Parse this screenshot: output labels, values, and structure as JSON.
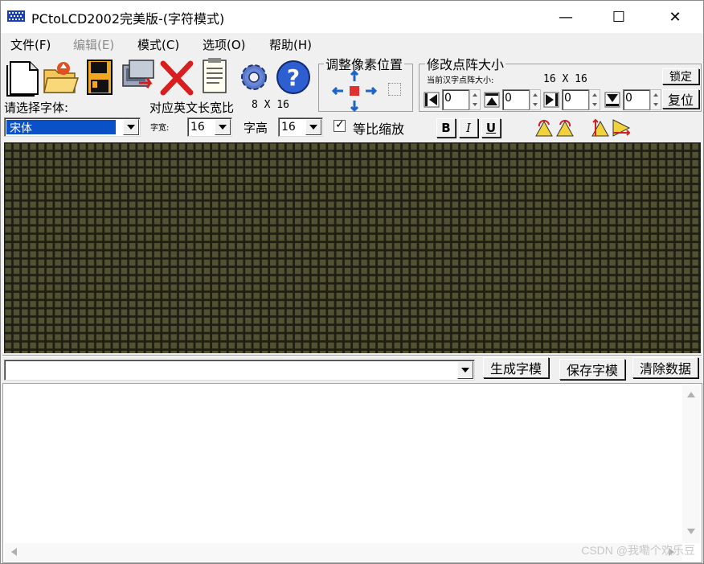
{
  "window": {
    "title": "PCtoLCD2002完美版-(字符模式)",
    "minimize_glyph": "—",
    "maximize_glyph": "☐",
    "close_glyph": "✕"
  },
  "menu": [
    {
      "label": "文件(F)",
      "disabled": false
    },
    {
      "label": "编辑(E)",
      "disabled": true
    },
    {
      "label": "模式(C)",
      "disabled": false
    },
    {
      "label": "选项(O)",
      "disabled": false
    },
    {
      "label": "帮助(H)",
      "disabled": false
    }
  ],
  "toolbar": {
    "icons": [
      "new-file-icon",
      "open-folder-icon",
      "save-disk-icon",
      "settings-computer-icon",
      "delete-x-icon",
      "notepad-icon",
      "gear-icon",
      "help-icon"
    ]
  },
  "font": {
    "select_label": "请选择字体:",
    "selected_font": "宋体",
    "ratio_label": "对应英文长宽比",
    "ratio_value": "8 X 16",
    "width_label": "字宽:",
    "width_value": "16",
    "height_label": "字高",
    "height_value": "16",
    "proportional_label": "等比缩放",
    "proportional_checked": true,
    "bold_label": "B",
    "italic_label": "I",
    "underline_label": "U"
  },
  "pixel_adjust": {
    "title": "调整像素位置"
  },
  "matrix_size": {
    "title": "修改点阵大小",
    "current_label": "当前汉字点阵大小:",
    "current_value": "16 X 16",
    "lock_label": "锁定",
    "reset_label": "复位",
    "spinners": [
      "0",
      "0",
      "0",
      "0"
    ]
  },
  "actions": {
    "input_value": "",
    "generate_label": "生成字模",
    "save_label": "保存字模",
    "clear_label": "清除数据"
  },
  "output": {
    "text": ""
  },
  "watermark": "CSDN @我嘞个欢乐豆",
  "colors": {
    "grid_cell": "#525232",
    "grid_line": "#1e1e14",
    "selection": "#0a50c8"
  }
}
